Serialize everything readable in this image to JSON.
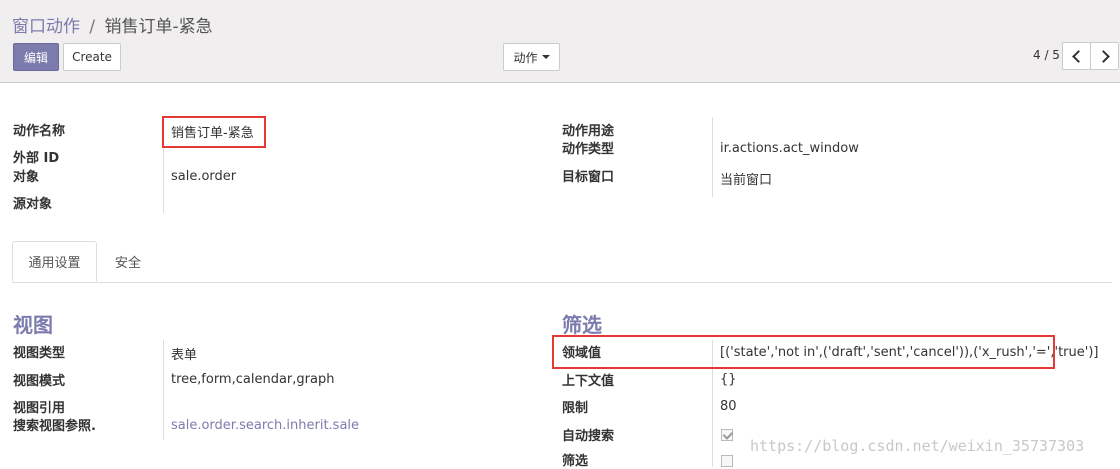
{
  "breadcrumb": {
    "parent": "窗口动作",
    "separator": "/",
    "current": "销售订单-紧急"
  },
  "toolbar": {
    "edit_label": "编辑",
    "create_label": "Create",
    "action_label": "动作"
  },
  "pager": {
    "value": "4 / 5"
  },
  "header_fields": {
    "name_label": "动作名称",
    "name_value": "销售订单-紧急",
    "external_id_label": "外部 ID",
    "object_label": "对象",
    "object_value": "sale.order",
    "source_label": "源对象",
    "usage_label": "动作用途",
    "type_label": "动作类型",
    "type_value": "ir.actions.act_window",
    "target_label": "目标窗口",
    "target_value": "当前窗口"
  },
  "tabs": [
    {
      "label": "通用设置"
    },
    {
      "label": "安全"
    }
  ],
  "views": {
    "title": "视图",
    "type_label": "视图类型",
    "type_value": "表单",
    "mode_label": "视图模式",
    "mode_value": "tree,form,calendar,graph",
    "ref_label": "视图引用",
    "search_ref_label": "搜索视图参照.",
    "search_ref_value": "sale.order.search.inherit.sale"
  },
  "filters": {
    "title": "筛选",
    "domain_label": "领域值",
    "domain_value": "[('state','not in',('draft','sent','cancel')),('x_rush','=','true')]",
    "context_label": "上下文值",
    "context_value": "{}",
    "limit_label": "限制",
    "limit_value": "80",
    "auto_search_label": "自动搜索",
    "auto_search_checked": true,
    "filter_label": "筛选",
    "filter_checked": false
  },
  "watermark": "https://blog.csdn.net/weixin_35737303",
  "colors": {
    "accent": "#7c7bad",
    "highlight": "#e53935"
  }
}
